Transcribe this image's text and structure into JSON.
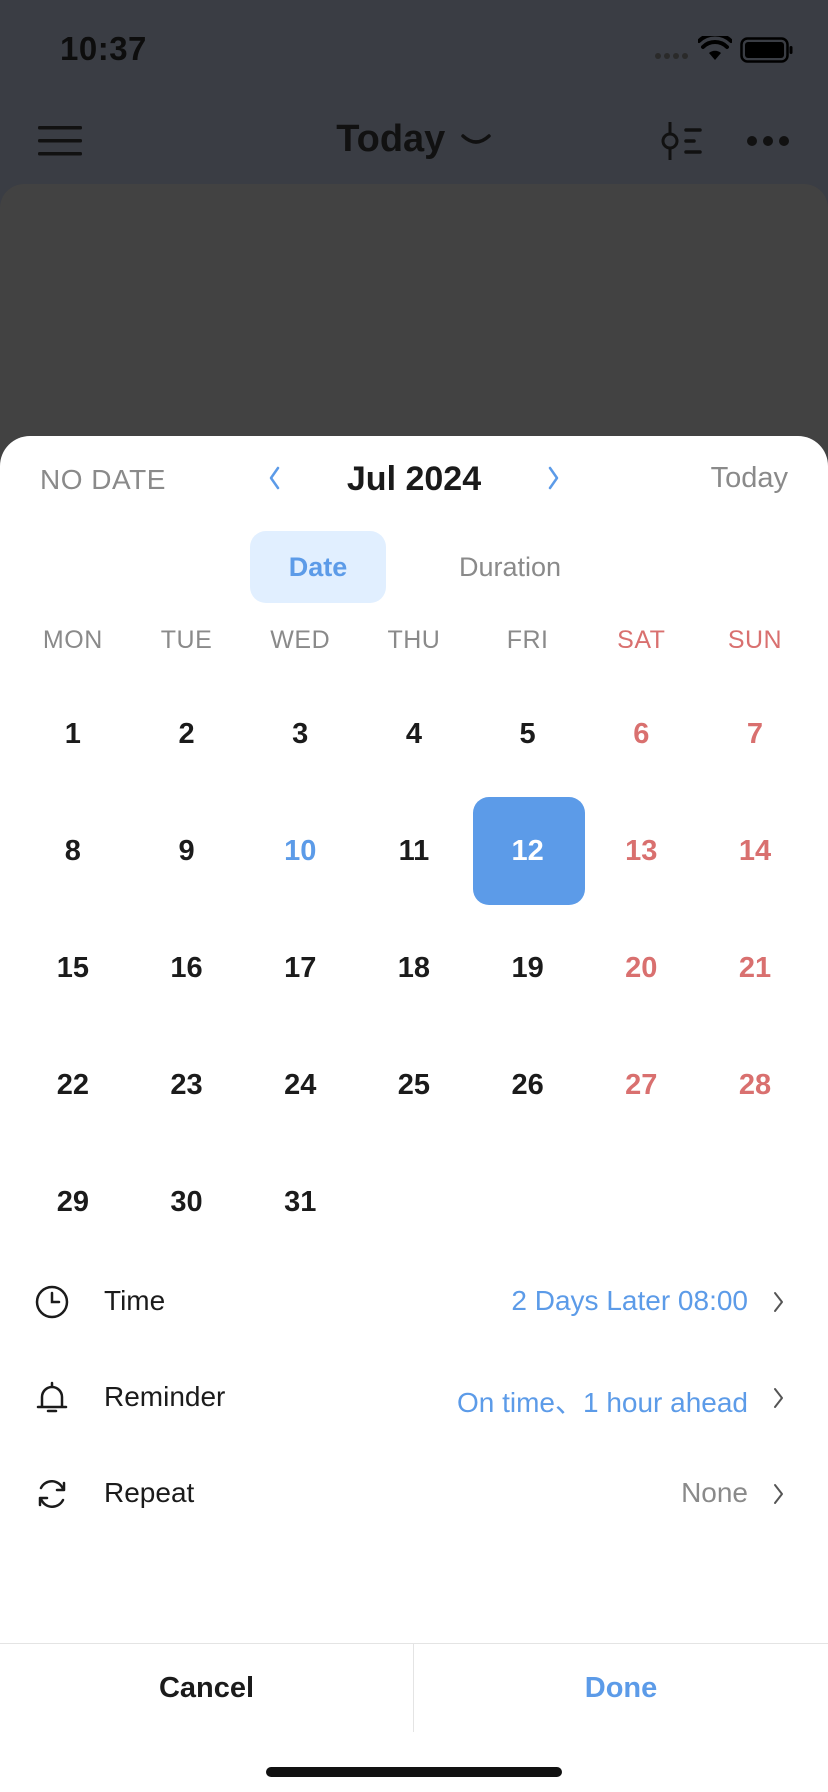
{
  "status_bar": {
    "time": "10:37"
  },
  "header": {
    "title": "Today"
  },
  "sheet": {
    "no_date": "NO DATE",
    "month": "Jul 2024",
    "today": "Today",
    "tabs": [
      {
        "label": "Date",
        "active": true
      },
      {
        "label": "Duration",
        "active": false
      }
    ],
    "weekdays": [
      "MON",
      "TUE",
      "WED",
      "THU",
      "FRI",
      "SAT",
      "SUN"
    ],
    "weeks": [
      [
        "1",
        "2",
        "3",
        "4",
        "5",
        "6",
        "7"
      ],
      [
        "8",
        "9",
        "10",
        "11",
        "12",
        "13",
        "14"
      ],
      [
        "15",
        "16",
        "17",
        "18",
        "19",
        "20",
        "21"
      ],
      [
        "22",
        "23",
        "24",
        "25",
        "26",
        "27",
        "28"
      ],
      [
        "29",
        "30",
        "31",
        "",
        "",
        "",
        ""
      ]
    ],
    "today_day": "10",
    "selected_day": "12",
    "options": [
      {
        "label": "Time",
        "value": "2 Days Later 08:00",
        "icon": "clock-icon"
      },
      {
        "label": "Reminder",
        "value": "On time、1 hour ahead",
        "icon": "bell-icon"
      },
      {
        "label": "Repeat",
        "value": "None",
        "icon": "repeat-icon"
      }
    ],
    "cancel_label": "Cancel",
    "done_label": "Done"
  },
  "colors": {
    "accent": "#5c9be8",
    "weekend": "#d9706f",
    "overlay": "#3a3d44"
  }
}
